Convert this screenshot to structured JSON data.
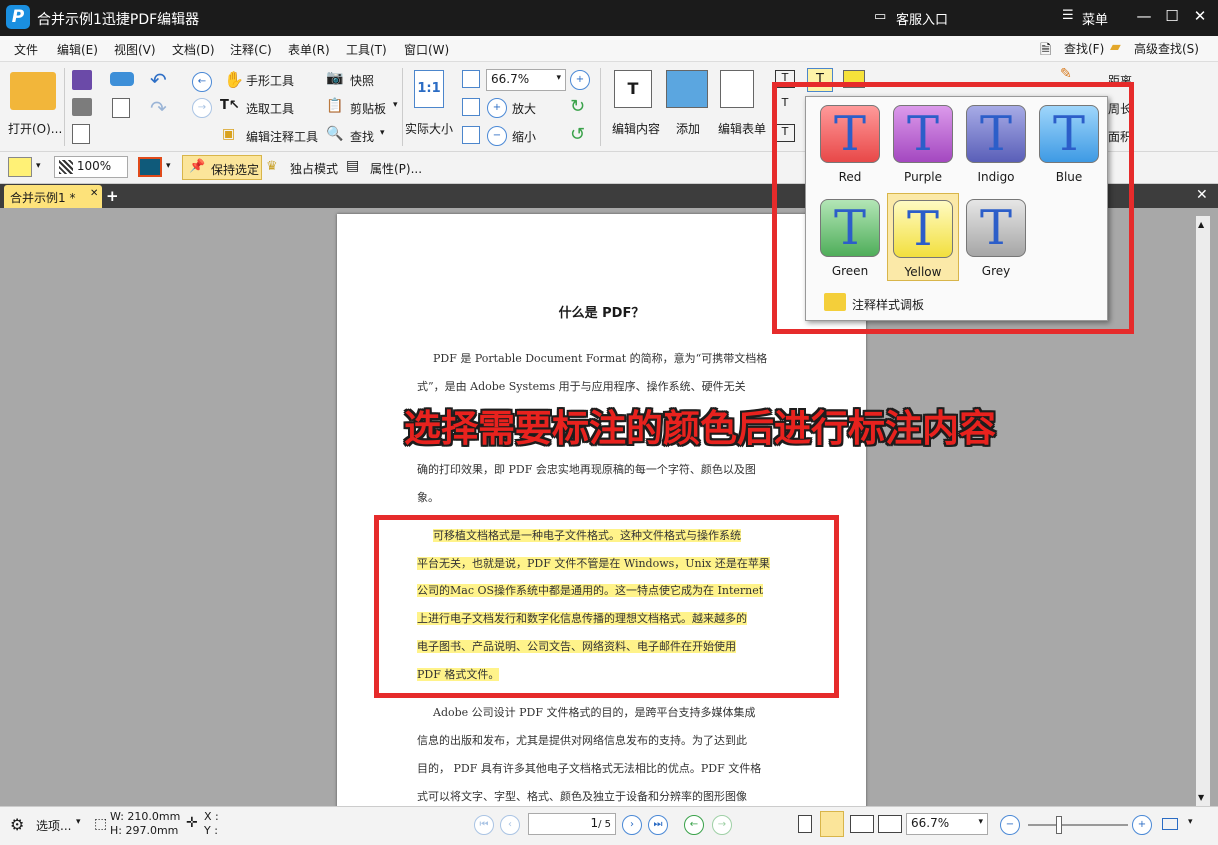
{
  "app": {
    "title": "合并示例1迅捷PDF编辑器",
    "logo_letter": "P",
    "support": "客服入口",
    "menu": "菜单"
  },
  "menubar": {
    "items": [
      "文件",
      "编辑(E)",
      "视图(V)",
      "文档(D)",
      "注释(C)",
      "表单(R)",
      "工具(T)",
      "窗口(W)"
    ],
    "find": "查找(F)",
    "advanced_find": "高级查找(S)"
  },
  "ribbon": {
    "open": "打开(O)...",
    "hand_tool": "手形工具",
    "select_tool": "选取工具",
    "edit_annot_tool": "编辑注释工具",
    "snapshot": "快照",
    "clipboard": "剪贴板",
    "find": "查找",
    "actual_size": "实际大小",
    "zoom_value": "66.7%",
    "zoom_in": "放大",
    "zoom_out": "缩小",
    "edit_content": "编辑内容",
    "add": "添加",
    "edit_form": "编辑表单",
    "distance": "距离",
    "perimeter": "周长",
    "area": "面积"
  },
  "toolbar2": {
    "opacity": "100%",
    "keep_selected": "保持选定",
    "exclusive_mode": "独占模式",
    "properties": "属性(P)..."
  },
  "tab": {
    "label": "合并示例1 *"
  },
  "page": {
    "title": "什么是 PDF？",
    "para1": [
      "PDF 是 Portable Document Format 的简称，意为“可携带文档格",
      "式”，是由 Adobe  Systems 用于与应用程序、操作系统、硬件无关",
      "确的打印效果，即 PDF 会忠实地再现原稿的每一个字符、颜色以及图",
      "象。"
    ],
    "para2": [
      "可移植文档格式是一种电子文件格式。这种文件格式与操作系统",
      "平台无关，也就是说，PDF 文件不管是在 Windows，Unix 还是在苹果",
      "公司的Mac OS操作系统中都是通用的。这一特点使它成为在 Internet",
      "上进行电子文档发行和数字化信息传播的理想文档格式。越来越多的",
      "电子图书、产品说明、公司文告、网络资料、电子邮件在开始使用",
      "PDF 格式文件。"
    ],
    "para3": [
      "Adobe 公司设计 PDF 文件格式的目的，是跨平台支持多媒体集成",
      "信息的出版和发布，尤其是提供对网络信息发布的支持。为了达到此",
      "目的， PDF 具有许多其他电子文档格式无法相比的优点。PDF 文件格",
      "式可以将文字、字型、格式、颜色及独立于设备和分辨率的图形图像"
    ]
  },
  "popup": {
    "swatches": [
      {
        "label": "Red",
        "color": "#f05a5a"
      },
      {
        "label": "Purple",
        "color": "#b05ac8"
      },
      {
        "label": "Indigo",
        "color": "#6a6fc4"
      },
      {
        "label": "Blue",
        "color": "#4aa6ee"
      },
      {
        "label": "Green",
        "color": "#5dbb6a"
      },
      {
        "label": "Yellow",
        "color": "#f6ea5a"
      },
      {
        "label": "Grey",
        "color": "#b9b9b9"
      }
    ],
    "footer": "注释样式调板"
  },
  "overlay_caption": "选择需要标注的颜色后进行标注内容",
  "statusbar": {
    "options": "选项...",
    "width": "W: 210.0mm",
    "height": "H: 297.0mm",
    "x": "X :",
    "y": "Y :",
    "page_current": "1",
    "page_total": "/ 5",
    "zoom": "66.7%"
  },
  "colors": {
    "highlight": "#fff38a",
    "annotation_red": "#e62b2b",
    "title_bg": "#1b1b1b",
    "tab_bg": "#fde27a"
  }
}
